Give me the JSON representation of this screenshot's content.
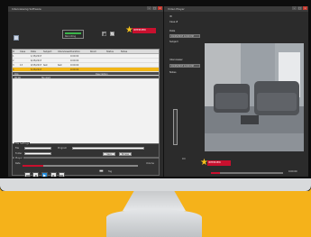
{
  "left_window": {
    "title": "Interviewing Software"
  },
  "right_window": {
    "title": "Video Player"
  },
  "toolbar": {
    "status_label": "Recording"
  },
  "logo": {
    "brand_text": "INTERVIEW"
  },
  "table": {
    "columns": [
      "#",
      "Case",
      "Date",
      "Subject",
      "Interviewer",
      "Duration",
      "Room",
      "Status",
      "Notes"
    ],
    "rows": [
      {
        "cells": [
          "1",
          "",
          "1/15/2017",
          "",
          "",
          "0:00:00",
          "",
          "",
          ""
        ],
        "selected": false
      },
      {
        "cells": [
          "2",
          "",
          "6/15/2017",
          "",
          "",
          "0:00:00",
          "",
          "",
          ""
        ],
        "selected": false
      },
      {
        "cells": [
          "3",
          "13",
          "9/15/2017",
          "test",
          "test",
          "0:00:00",
          "",
          "",
          ""
        ],
        "selected": false
      },
      {
        "cells": [
          "4",
          "",
          "5/15/2017",
          "",
          "",
          "0:00:00",
          "",
          "",
          ""
        ],
        "selected": true
      }
    ],
    "detail_rows": [
      [
        "Clip",
        "",
        "Description"
      ],
      [
        "00:00",
        "file start",
        ""
      ]
    ]
  },
  "file_panel": {
    "title": "File Settings",
    "file_label": "File",
    "folder_label": "Folder",
    "program_label": "Program",
    "save_label": "Save",
    "browse_label": "Browse"
  },
  "player_panel": {
    "title": "Player",
    "rate_label": "Rate",
    "volume_label": "Volume",
    "tag_label": "Tag",
    "progress": 0.18
  },
  "right_info": {
    "id_label": "ID",
    "case_label": "Case #",
    "date_label": "Date",
    "date_value": "01/15/2017 12:00 PM",
    "subject_label": "Subject",
    "interviewer_label": "Interviewer",
    "interviewer_value": "01/15/2017 12:00 PM",
    "notes_label": "Notes",
    "player_time": "0:00:00",
    "player_progress": 0.12
  },
  "colors": {
    "accent": "#f1b617",
    "brand": "#c8102e",
    "background": "#f5b21a"
  }
}
